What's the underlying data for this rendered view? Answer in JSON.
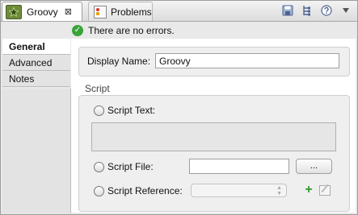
{
  "tabs": [
    {
      "label": "Groovy",
      "close": "⊠",
      "active": true
    },
    {
      "label": "Problems",
      "active": false
    }
  ],
  "toolbar": {
    "icons": [
      "save-icon",
      "tree-icon",
      "help-icon",
      "dropdown-icon"
    ]
  },
  "status": {
    "message": "There are no errors."
  },
  "nav": {
    "items": [
      "General",
      "Advanced",
      "Notes"
    ],
    "active": "General"
  },
  "form": {
    "display_name_label": "Display Name:",
    "display_name_value": "Groovy",
    "script_section": "Script",
    "script_text_label": "Script Text:",
    "script_file_label": "Script File:",
    "browse_button": "...",
    "script_reference_label": "Script Reference:"
  }
}
